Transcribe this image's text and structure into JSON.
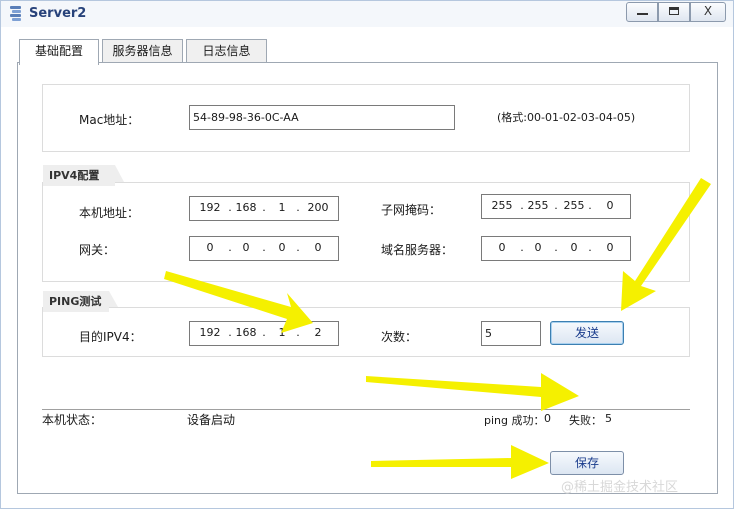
{
  "window": {
    "title": "Server2",
    "minimize": "minimize",
    "maximize": "maximize",
    "close_glyph": "X"
  },
  "tabs": [
    {
      "label": "基础配置",
      "active": true
    },
    {
      "label": "服务器信息",
      "active": false
    },
    {
      "label": "日志信息",
      "active": false
    }
  ],
  "mac": {
    "label": "Mac地址：",
    "value": "54-89-98-36-0C-AA",
    "hint": "(格式:00-01-02-03-04-05)"
  },
  "ipv4": {
    "section_label": "IPV4配置",
    "local_ip_label": "本机地址：",
    "local_ip": [
      "192",
      "168",
      "1",
      "200"
    ],
    "mask_label": "子网掩码：",
    "mask": [
      "255",
      "255",
      "255",
      "0"
    ],
    "gateway_label": "网关：",
    "gateway": [
      "0",
      "0",
      "0",
      "0"
    ],
    "dns_label": "域名服务器：",
    "dns": [
      "0",
      "0",
      "0",
      "0"
    ]
  },
  "ping": {
    "section_label": "PING测试",
    "dest_label": "目的IPV4：",
    "dest": [
      "192",
      "168",
      "1",
      "2"
    ],
    "count_label": "次数：",
    "count": "5",
    "send_button": "发送"
  },
  "status": {
    "label": "本机状态：",
    "value": "设备启动",
    "ping_success_label": "ping 成功：",
    "ping_success": "0",
    "fail_label": "失败：",
    "fail": "5"
  },
  "save_button": "保存",
  "watermark": "@稀土掘金技术社区",
  "colors": {
    "arrow": "#f5f000",
    "title_text": "#27427a",
    "button_text": "#1a3c8c"
  }
}
